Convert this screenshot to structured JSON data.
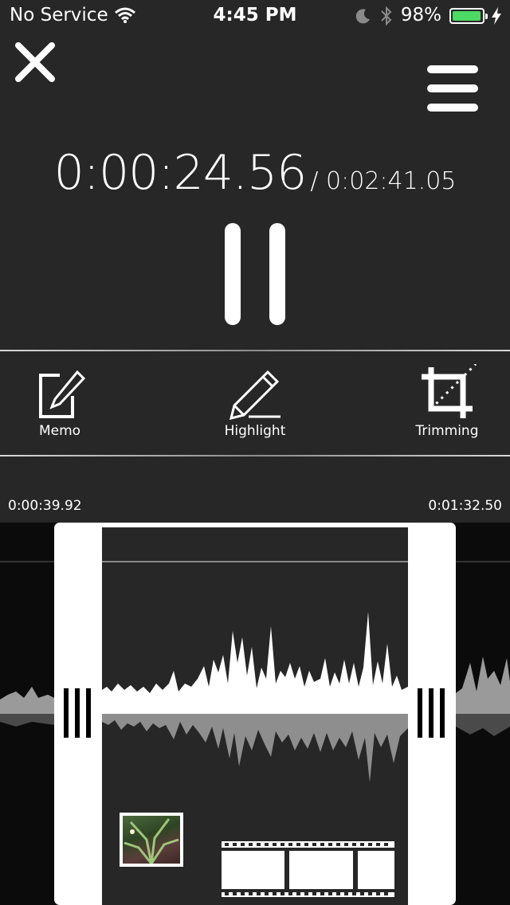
{
  "status_bar": {
    "carrier": "No Service",
    "time": "4:45 PM",
    "battery_percent": "98%",
    "battery_level": 0.98,
    "battery_color": "#4cd964"
  },
  "header": {
    "close_icon": "close-icon",
    "menu_icon": "hamburger-menu-icon"
  },
  "player": {
    "current_time": "0:00:24.56",
    "total_time": "/ 0:02:41.05",
    "pause_icon": "pause-icon"
  },
  "toolbar": {
    "items": [
      {
        "label": "Memo",
        "icon": "memo-edit-icon"
      },
      {
        "label": "Highlight",
        "icon": "pencil-icon"
      },
      {
        "label": "Trimming",
        "icon": "crop-icon"
      }
    ]
  },
  "range": {
    "start": "0:00:39.92",
    "end": "0:01:32.50"
  },
  "waveform": {
    "icons": [
      "photo-thumbnail",
      "film-strip-icon"
    ]
  }
}
